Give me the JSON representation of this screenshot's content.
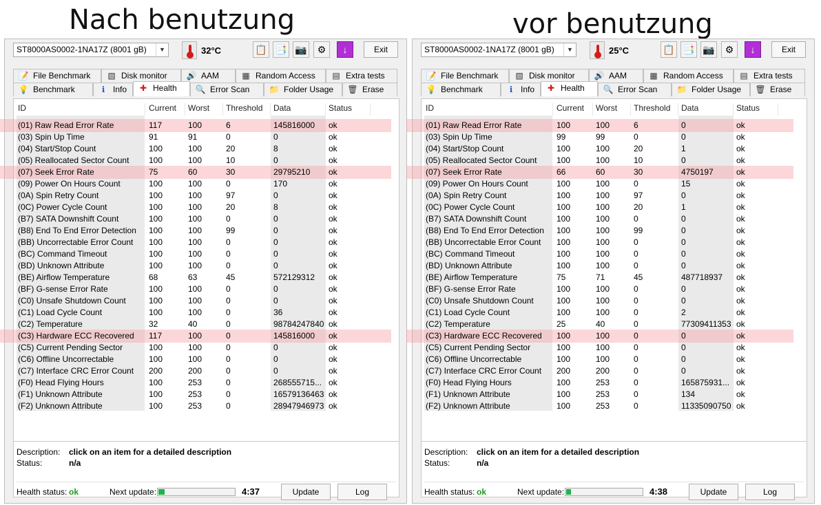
{
  "captions": {
    "left": "Nach benutzung",
    "right": "vor benutzung"
  },
  "tabs": {
    "row1": [
      {
        "label": "File Benchmark",
        "icon": "file-benchmark-icon"
      },
      {
        "label": "Disk monitor",
        "icon": "disk-monitor-icon"
      },
      {
        "label": "AAM",
        "icon": "speaker-icon"
      },
      {
        "label": "Random Access",
        "icon": "random-access-icon"
      },
      {
        "label": "Extra tests",
        "icon": "extra-tests-icon"
      }
    ],
    "row2": [
      {
        "label": "Benchmark",
        "icon": "lightbulb-icon"
      },
      {
        "label": "Info",
        "icon": "info-icon"
      },
      {
        "label": "Health",
        "icon": "health-cross-icon"
      },
      {
        "label": "Error Scan",
        "icon": "magnifier-icon"
      },
      {
        "label": "Folder Usage",
        "icon": "folder-icon"
      },
      {
        "label": "Erase",
        "icon": "trash-icon"
      }
    ],
    "active": "Health"
  },
  "columns": [
    "ID",
    "Current",
    "Worst",
    "Threshold",
    "Data",
    "Status"
  ],
  "exit_label": "Exit",
  "description_label": "Description:",
  "description_text": "click on an item for a detailed description",
  "status_label": "Status:",
  "status_value": "n/a",
  "health_status_label": "Health status:",
  "health_status_value": "ok",
  "next_update_label": "Next update:",
  "update_label": "Update",
  "log_label": "Log",
  "colors": {
    "health_ok": "#1a9a1a",
    "highlight": "#f5a0a5",
    "progress": "#22b14c",
    "thermometer": "#d41b1b"
  },
  "panels": [
    {
      "drive": "ST8000AS0002-1NA17Z (8001 gB)",
      "temperature": "32°C",
      "next_update_time": "4:37",
      "progress_fraction": 0.08,
      "rows": [
        [
          "(01) Raw Read Error Rate",
          "117",
          "100",
          "6",
          "145816000",
          "ok"
        ],
        [
          "(03) Spin Up Time",
          "91",
          "91",
          "0",
          "0",
          "ok"
        ],
        [
          "(04) Start/Stop Count",
          "100",
          "100",
          "20",
          "8",
          "ok"
        ],
        [
          "(05) Reallocated Sector Count",
          "100",
          "100",
          "10",
          "0",
          "ok"
        ],
        [
          "(07) Seek Error Rate",
          "75",
          "60",
          "30",
          "29795210",
          "ok"
        ],
        [
          "(09) Power On Hours Count",
          "100",
          "100",
          "0",
          "170",
          "ok"
        ],
        [
          "(0A) Spin Retry Count",
          "100",
          "100",
          "97",
          "0",
          "ok"
        ],
        [
          "(0C) Power Cycle Count",
          "100",
          "100",
          "20",
          "8",
          "ok"
        ],
        [
          "(B7) SATA Downshift Count",
          "100",
          "100",
          "0",
          "0",
          "ok"
        ],
        [
          "(B8) End To End Error Detection",
          "100",
          "100",
          "99",
          "0",
          "ok"
        ],
        [
          "(BB) Uncorrectable Error Count",
          "100",
          "100",
          "0",
          "0",
          "ok"
        ],
        [
          "(BC) Command Timeout",
          "100",
          "100",
          "0",
          "0",
          "ok"
        ],
        [
          "(BD) Unknown Attribute",
          "100",
          "100",
          "0",
          "0",
          "ok"
        ],
        [
          "(BE) Airflow Temperature",
          "68",
          "63",
          "45",
          "572129312",
          "ok"
        ],
        [
          "(BF) G-sense Error Rate",
          "100",
          "100",
          "0",
          "0",
          "ok"
        ],
        [
          "(C0) Unsafe Shutdown Count",
          "100",
          "100",
          "0",
          "0",
          "ok"
        ],
        [
          "(C1) Load Cycle Count",
          "100",
          "100",
          "0",
          "36",
          "ok"
        ],
        [
          "(C2) Temperature",
          "32",
          "40",
          "0",
          "98784247840",
          "ok"
        ],
        [
          "(C3) Hardware ECC Recovered",
          "117",
          "100",
          "0",
          "145816000",
          "ok"
        ],
        [
          "(C5) Current Pending Sector",
          "100",
          "100",
          "0",
          "0",
          "ok"
        ],
        [
          "(C6) Offline Uncorrectable",
          "100",
          "100",
          "0",
          "0",
          "ok"
        ],
        [
          "(C7) Interface CRC Error Count",
          "200",
          "200",
          "0",
          "0",
          "ok"
        ],
        [
          "(F0) Head Flying Hours",
          "100",
          "253",
          "0",
          "268555715...",
          "ok"
        ],
        [
          "(F1) Unknown Attribute",
          "100",
          "253",
          "0",
          "16579136463",
          "ok"
        ],
        [
          "(F2) Unknown Attribute",
          "100",
          "253",
          "0",
          "28947946973",
          "ok"
        ]
      ],
      "highlight_rows": [
        0,
        4,
        18
      ]
    },
    {
      "drive": "ST8000AS0002-1NA17Z (8001 gB)",
      "temperature": "25°C",
      "next_update_time": "4:38",
      "progress_fraction": 0.06,
      "rows": [
        [
          "(01) Raw Read Error Rate",
          "100",
          "100",
          "6",
          "0",
          "ok"
        ],
        [
          "(03) Spin Up Time",
          "99",
          "99",
          "0",
          "0",
          "ok"
        ],
        [
          "(04) Start/Stop Count",
          "100",
          "100",
          "20",
          "1",
          "ok"
        ],
        [
          "(05) Reallocated Sector Count",
          "100",
          "100",
          "10",
          "0",
          "ok"
        ],
        [
          "(07) Seek Error Rate",
          "66",
          "60",
          "30",
          "4750197",
          "ok"
        ],
        [
          "(09) Power On Hours Count",
          "100",
          "100",
          "0",
          "15",
          "ok"
        ],
        [
          "(0A) Spin Retry Count",
          "100",
          "100",
          "97",
          "0",
          "ok"
        ],
        [
          "(0C) Power Cycle Count",
          "100",
          "100",
          "20",
          "1",
          "ok"
        ],
        [
          "(B7) SATA Downshift Count",
          "100",
          "100",
          "0",
          "0",
          "ok"
        ],
        [
          "(B8) End To End Error Detection",
          "100",
          "100",
          "99",
          "0",
          "ok"
        ],
        [
          "(BB) Uncorrectable Error Count",
          "100",
          "100",
          "0",
          "0",
          "ok"
        ],
        [
          "(BC) Command Timeout",
          "100",
          "100",
          "0",
          "0",
          "ok"
        ],
        [
          "(BD) Unknown Attribute",
          "100",
          "100",
          "0",
          "0",
          "ok"
        ],
        [
          "(BE) Airflow Temperature",
          "75",
          "71",
          "45",
          "487718937",
          "ok"
        ],
        [
          "(BF) G-sense Error Rate",
          "100",
          "100",
          "0",
          "0",
          "ok"
        ],
        [
          "(C0) Unsafe Shutdown Count",
          "100",
          "100",
          "0",
          "0",
          "ok"
        ],
        [
          "(C1) Load Cycle Count",
          "100",
          "100",
          "0",
          "2",
          "ok"
        ],
        [
          "(C2) Temperature",
          "25",
          "40",
          "0",
          "77309411353",
          "ok"
        ],
        [
          "(C3) Hardware ECC Recovered",
          "100",
          "100",
          "0",
          "0",
          "ok"
        ],
        [
          "(C5) Current Pending Sector",
          "100",
          "100",
          "0",
          "0",
          "ok"
        ],
        [
          "(C6) Offline Uncorrectable",
          "100",
          "100",
          "0",
          "0",
          "ok"
        ],
        [
          "(C7) Interface CRC Error Count",
          "200",
          "200",
          "0",
          "0",
          "ok"
        ],
        [
          "(F0) Head Flying Hours",
          "100",
          "253",
          "0",
          "165875931...",
          "ok"
        ],
        [
          "(F1) Unknown Attribute",
          "100",
          "253",
          "0",
          "134",
          "ok"
        ],
        [
          "(F2) Unknown Attribute",
          "100",
          "253",
          "0",
          "11335090750",
          "ok"
        ]
      ],
      "highlight_rows": [
        0,
        4,
        18
      ]
    }
  ]
}
